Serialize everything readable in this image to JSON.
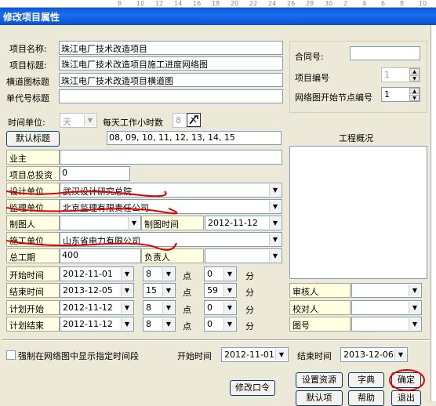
{
  "ruler": {
    "ticks": [
      "8",
      "10",
      "12",
      "14",
      "16",
      "18",
      "20",
      "22",
      "24",
      "26",
      "28",
      "30",
      "2",
      "4",
      "6",
      "8",
      "10"
    ]
  },
  "dialog": {
    "title": "修改项目属性",
    "project_name": {
      "label": "项目名称:",
      "value": "珠江电厂技术改造项目"
    },
    "project_title": {
      "label": "项目标题:",
      "value": "珠江电厂技术改造项目施工进度网络图"
    },
    "bar_chart_title": {
      "label": "横道图标题",
      "value": "珠江电厂技术改造项目横道图"
    },
    "unit_title": {
      "label": "单代号标题",
      "value": ""
    },
    "time_unit": {
      "label": "时间单位:",
      "value": "天"
    },
    "work_hours": {
      "label": "每天工作小时数",
      "value": "8"
    },
    "default_title_button": "默认标题",
    "hours_list": "08, 09, 10, 11, 12, 13, 14, 15",
    "contract_no": {
      "label": "合同号:",
      "value": ""
    },
    "project_no": {
      "label": "项目编号",
      "value": "1"
    },
    "start_node_no": {
      "label": "网络图开始节点编号",
      "value": "1"
    },
    "overview_label": "工程概况",
    "owner": {
      "label": "业主",
      "value": ""
    },
    "total_investment": {
      "label": "项目总投资",
      "value": "0"
    },
    "design_unit": {
      "label": "设计单位",
      "value": "武汉设计研究总院"
    },
    "supervision_unit": {
      "label": "监理单位",
      "value": "北京监理有限责任公司"
    },
    "drafter": {
      "label": "制图人",
      "value": ""
    },
    "draw_time": {
      "label": "制图时间",
      "value": "2012-11-12"
    },
    "construction_unit": {
      "label": "施工单位",
      "value": "山东省电力有限公司"
    },
    "total_period": {
      "label": "总工期",
      "value": "400"
    },
    "responsible": {
      "label": "负责人",
      "value": ""
    },
    "start_time": {
      "label": "开始时间",
      "date": "2012-11-01",
      "hour": "8",
      "minute": "0"
    },
    "end_time": {
      "label": "结束时间",
      "date": "2013-12-05",
      "hour": "15",
      "minute": "59"
    },
    "plan_start": {
      "label": "计划开始",
      "date": "2012-11-12",
      "hour": "8",
      "minute": "0"
    },
    "plan_end": {
      "label": "计划结束",
      "date": "2012-11-12",
      "hour": "8",
      "minute": "0"
    },
    "hour_unit": "点",
    "minute_unit": "分",
    "reviewer": {
      "label": "审核人",
      "value": ""
    },
    "checker": {
      "label": "校对人",
      "value": ""
    },
    "drawing_no": {
      "label": "图号",
      "value": ""
    },
    "force_display": {
      "label": "强制在网络图中显示指定时间段",
      "checked": false
    },
    "range_start": {
      "label": "开始时间",
      "value": "2012-11-01"
    },
    "range_end": {
      "label": "结束时间",
      "value": "2013-12-06"
    },
    "buttons": {
      "set_resources": "设置资源",
      "dictionary": "字典",
      "ok": "确定",
      "modify_password": "修改口令",
      "default_item": "默认项",
      "help": "帮助",
      "exit": "退出"
    }
  }
}
